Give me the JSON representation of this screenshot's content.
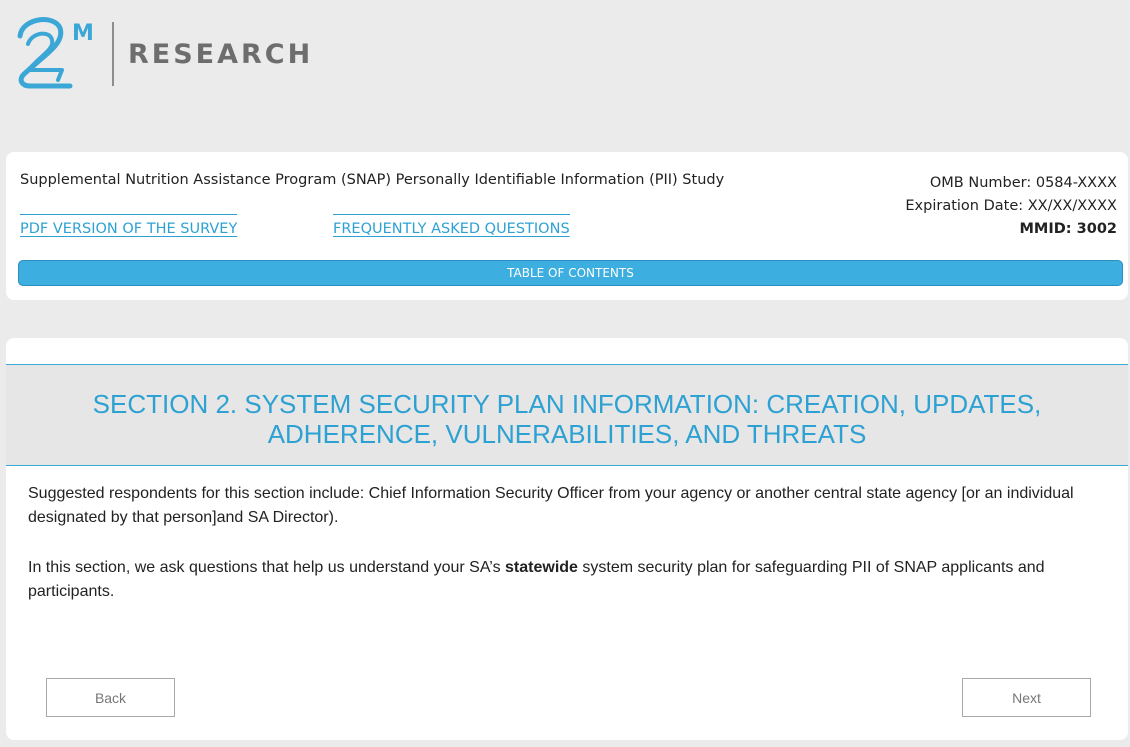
{
  "brand": {
    "logo_mark": "2M",
    "name": "RESEARCH"
  },
  "header": {
    "study_title": "Supplemental Nutrition Assistance Program (SNAP) Personally Identifiable Information (PII) Study",
    "omb_number": "OMB Number: 0584-XXXX",
    "expiration_date": "Expiration Date: XX/XX/XXXX",
    "mmid": "MMID: 3002",
    "links": {
      "pdf": "PDF VERSION OF THE SURVEY",
      "faq": "FREQUENTLY ASKED QUESTIONS"
    },
    "toc_label": "TABLE OF CONTENTS"
  },
  "section": {
    "title_line1": "SECTION 2. SYSTEM SECURITY PLAN INFORMATION: CREATION, UPDATES,",
    "title_line2": "ADHERENCE, VULNERABILITIES, AND THREATS",
    "para1": "Suggested respondents for this section include: Chief Information Security Officer from your agency or another central state agency [or an individual designated by that person]and SA Director).",
    "para2_before": "In this section, we ask questions that help us understand your SA’s ",
    "para2_bold": "statewide",
    "para2_after": " system security plan for safeguarding PII of SNAP applicants and participants."
  },
  "nav": {
    "back_label": "Back",
    "next_label": "Next"
  },
  "colors": {
    "accent": "#2ea1d3",
    "toc_bar": "#3daee0",
    "page_bg": "#ebebeb"
  }
}
